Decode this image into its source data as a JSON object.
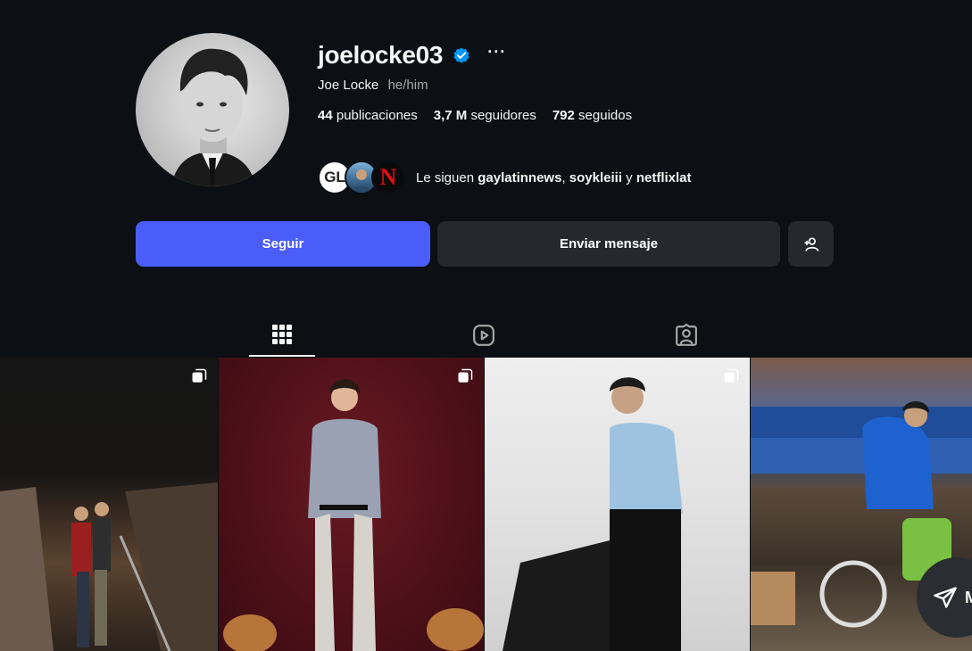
{
  "profile": {
    "username": "joelocke03",
    "more_label": "···",
    "full_name": "Joe Locke",
    "pronouns": "he/him",
    "stats": [
      {
        "count": "44",
        "label": "publicaciones"
      },
      {
        "count": "3,7 M",
        "label": "seguidores"
      },
      {
        "count": "792",
        "label": "seguidos"
      }
    ],
    "followed_by": {
      "prefix": "Le siguen",
      "accounts": [
        "gaylatinnews",
        "soykleiii",
        "netflixlat"
      ],
      "sep1": ",",
      "sep2": "y",
      "avatar_g_text": "GL",
      "avatar_n_text": "N"
    }
  },
  "actions": {
    "follow_label": "Seguir",
    "message_label": "Enviar mensaje",
    "follow_color": "#4a5df9"
  },
  "tabs": [
    {
      "icon": "grid-icon",
      "active": true
    },
    {
      "icon": "reels-icon",
      "active": false
    },
    {
      "icon": "tagged-icon",
      "active": false
    }
  ],
  "grid": {
    "posts": [
      {
        "multi": true
      },
      {
        "multi": true
      },
      {
        "multi": true
      },
      {
        "multi": false
      }
    ]
  },
  "floating": {
    "label": "M"
  }
}
